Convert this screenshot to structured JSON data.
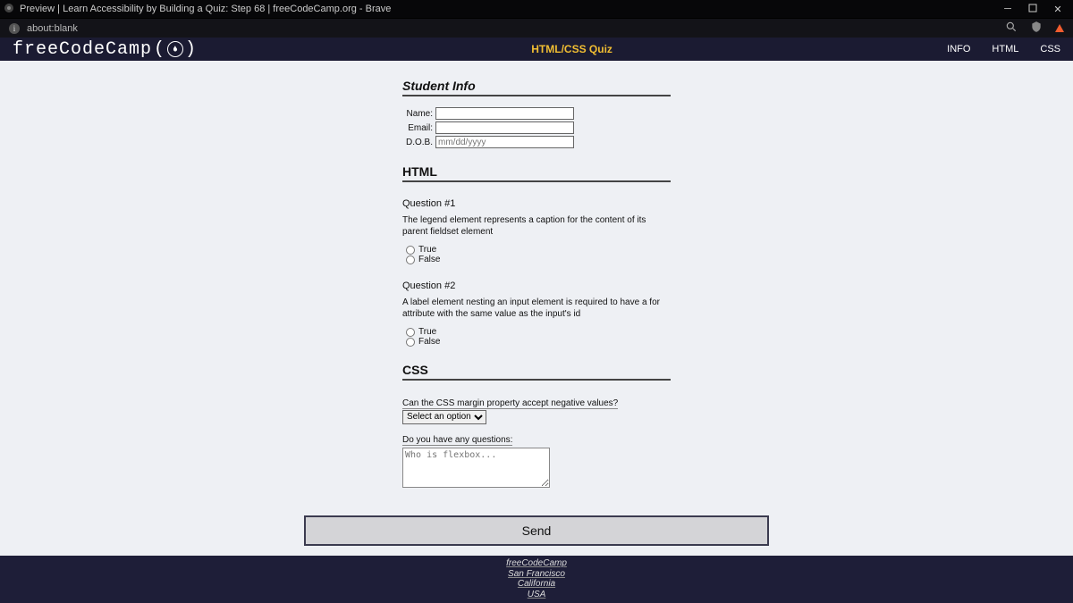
{
  "window": {
    "title": "Preview | Learn Accessibility by Building a Quiz: Step 68 | freeCodeCamp.org - Brave"
  },
  "address": {
    "url": "about:blank"
  },
  "header": {
    "logo_text": "freeCodeCamp",
    "title": "HTML/CSS Quiz",
    "nav": {
      "info": "INFO",
      "html": "HTML",
      "css": "CSS"
    }
  },
  "sections": {
    "student_info": {
      "heading": "Student Info",
      "name_label": "Name:",
      "email_label": "Email:",
      "dob_label": "D.O.B.",
      "dob_placeholder": "mm/dd/yyyy"
    },
    "html": {
      "heading": "HTML",
      "q1": {
        "title": "Question #1",
        "text": "The legend element represents a caption for the content of its parent fieldset element",
        "opt_true": "True",
        "opt_false": "False"
      },
      "q2": {
        "title": "Question #2",
        "text": "A label element nesting an input element is required to have a for attribute with the same value as the input's id",
        "opt_true": "True",
        "opt_false": "False"
      }
    },
    "css": {
      "heading": "CSS",
      "q_text": "Can the CSS margin property accept negative values?",
      "select_default": "Select an option",
      "ta_label": "Do you have any questions:",
      "ta_placeholder": "Who is flexbox..."
    }
  },
  "submit": {
    "label": "Send"
  },
  "footer": {
    "l1": "freeCodeCamp",
    "l2": "San Francisco",
    "l3": "California",
    "l4": "USA"
  }
}
